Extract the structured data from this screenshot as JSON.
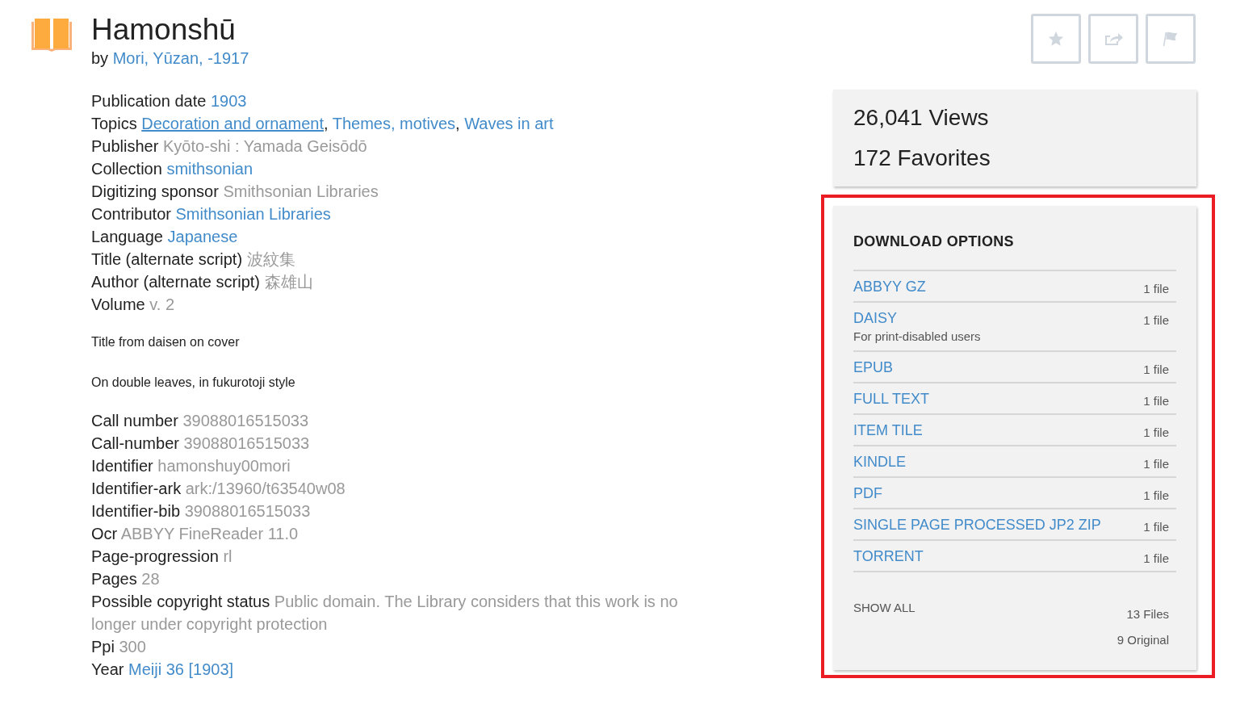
{
  "header": {
    "title": "Hamonshū",
    "byline_prefix": "by",
    "author": "Mori, Yūzan, -1917"
  },
  "actions": [
    {
      "kind": "star"
    },
    {
      "kind": "share"
    },
    {
      "kind": "flag"
    }
  ],
  "metadata": [
    {
      "label": "Publication date",
      "values": [
        {
          "text": "1903",
          "kind": "link"
        }
      ]
    },
    {
      "label": "Topics",
      "values": [
        {
          "text": "Decoration and ornament",
          "kind": "link",
          "underlined": true,
          "separator": ","
        },
        {
          "text": "Themes, motives",
          "kind": "link",
          "underlined": false,
          "separator": ","
        },
        {
          "text": "Waves in art",
          "kind": "link",
          "underlined": false
        }
      ]
    },
    {
      "label": "Publisher",
      "values": [
        {
          "text": "Kyōto-shi : Yamada Geisōdō",
          "kind": "plain"
        }
      ]
    },
    {
      "label": "Collection",
      "values": [
        {
          "text": "smithsonian",
          "kind": "link"
        }
      ]
    },
    {
      "label": "Digitizing sponsor",
      "values": [
        {
          "text": "Smithsonian Libraries",
          "kind": "plain"
        }
      ]
    },
    {
      "label": "Contributor",
      "values": [
        {
          "text": "Smithsonian Libraries",
          "kind": "link"
        }
      ]
    },
    {
      "label": "Language",
      "values": [
        {
          "text": "Japanese",
          "kind": "link"
        }
      ]
    },
    {
      "label": "Title (alternate script)",
      "values": [
        {
          "text": "波紋集",
          "kind": "plain"
        }
      ]
    },
    {
      "label": "Author (alternate script)",
      "values": [
        {
          "text": "森雄山",
          "kind": "plain"
        }
      ]
    },
    {
      "label": "Volume",
      "values": [
        {
          "text": "v. 2",
          "kind": "plain"
        }
      ]
    }
  ],
  "notes": [
    "Title from daisen on cover",
    "On double leaves, in fukurotoji style"
  ],
  "metadata_more": [
    {
      "label": "Call number",
      "values": [
        {
          "text": "39088016515033",
          "kind": "plain"
        }
      ]
    },
    {
      "label": "Call-number",
      "values": [
        {
          "text": "39088016515033",
          "kind": "plain"
        }
      ]
    },
    {
      "label": "Identifier",
      "values": [
        {
          "text": "hamonshuy00mori",
          "kind": "plain"
        }
      ]
    },
    {
      "label": "Identifier-ark",
      "values": [
        {
          "text": "ark:/13960/t63540w08",
          "kind": "plain"
        }
      ]
    },
    {
      "label": "Identifier-bib",
      "values": [
        {
          "text": "39088016515033",
          "kind": "plain"
        }
      ]
    },
    {
      "label": "Ocr",
      "values": [
        {
          "text": "ABBYY FineReader 11.0",
          "kind": "plain"
        }
      ]
    },
    {
      "label": "Page-progression",
      "values": [
        {
          "text": "rl",
          "kind": "plain"
        }
      ]
    },
    {
      "label": "Pages",
      "values": [
        {
          "text": "28",
          "kind": "plain"
        }
      ]
    },
    {
      "label": "Possible copyright status",
      "values": [
        {
          "text": "Public domain. The Library considers that this work is no longer under copyright protection",
          "kind": "plain"
        }
      ]
    },
    {
      "label": "Ppi",
      "values": [
        {
          "text": "300",
          "kind": "plain"
        }
      ]
    },
    {
      "label": "Year",
      "values": [
        {
          "text": "Meiji 36 [1903]",
          "kind": "link"
        }
      ]
    }
  ],
  "stats": [
    "26,041 Views",
    "172 Favorites"
  ],
  "downloads": {
    "title": "DOWNLOAD OPTIONS",
    "items": [
      {
        "name": "ABBYY GZ",
        "count": "1 file"
      },
      {
        "name": "DAISY",
        "subtitle": "For print-disabled users",
        "count": "1 file"
      },
      {
        "name": "EPUB",
        "count": "1 file"
      },
      {
        "name": "FULL TEXT",
        "count": "1 file"
      },
      {
        "name": "ITEM TILE",
        "count": "1 file"
      },
      {
        "name": "KINDLE",
        "count": "1 file"
      },
      {
        "name": "PDF",
        "count": "1 file"
      },
      {
        "name": "SINGLE PAGE PROCESSED JP2 ZIP",
        "count": "1 file"
      },
      {
        "name": "TORRENT",
        "count": "1 file"
      }
    ],
    "show_all": "SHOW ALL",
    "total": "13 Files",
    "original": "9 Original"
  }
}
